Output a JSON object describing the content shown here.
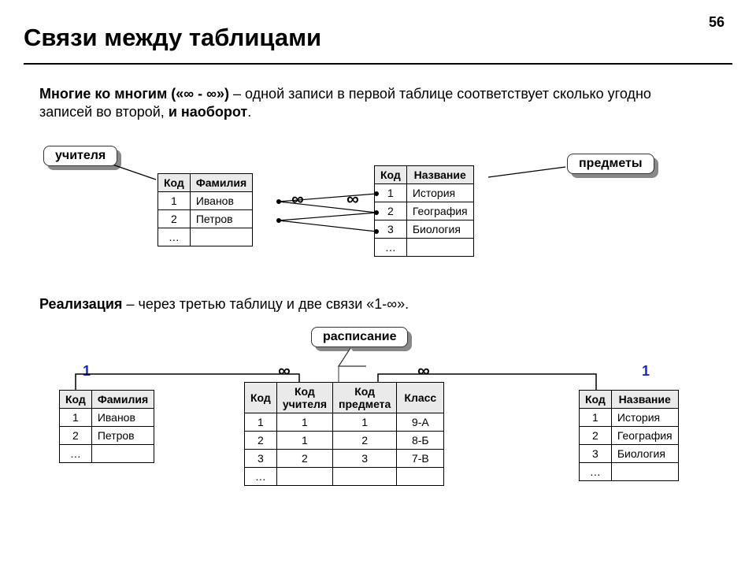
{
  "page_number": "56",
  "title": "Связи между таблицами",
  "intro": {
    "bold_lead": "Многие ко многим («",
    "inf1": "∞",
    "mid": " - ",
    "inf2": "∞",
    "bold_tail": "»)",
    "rest": " – одной записи в первой таблице соответствует сколько угодно записей во второй, ",
    "bold_end": "и наоборот",
    "dot": "."
  },
  "callouts": {
    "teachers": "учителя",
    "subjects": "предметы",
    "schedule": "расписание"
  },
  "teachers_table": {
    "headers": [
      "Код",
      "Фамилия"
    ],
    "rows": [
      [
        "1",
        "Иванов"
      ],
      [
        "2",
        "Петров"
      ],
      [
        "…",
        ""
      ]
    ]
  },
  "subjects_table": {
    "headers": [
      "Код",
      "Название"
    ],
    "rows": [
      [
        "1",
        "История"
      ],
      [
        "2",
        "География"
      ],
      [
        "3",
        "Биология"
      ],
      [
        "…",
        ""
      ]
    ]
  },
  "realization": {
    "bold": "Реализация",
    "rest": " – через третью таблицу и две связи «1-",
    "inf": "∞",
    "end": "»."
  },
  "schedule_table": {
    "headers": [
      "Код",
      "Код учителя",
      "Код предмета",
      "Класс"
    ],
    "rows": [
      [
        "1",
        "1",
        "1",
        "9-А"
      ],
      [
        "2",
        "1",
        "2",
        "8-Б"
      ],
      [
        "3",
        "2",
        "3",
        "7-В"
      ],
      [
        "…",
        "",
        "",
        ""
      ]
    ]
  },
  "symbols": {
    "inf": "∞",
    "one": "1"
  }
}
